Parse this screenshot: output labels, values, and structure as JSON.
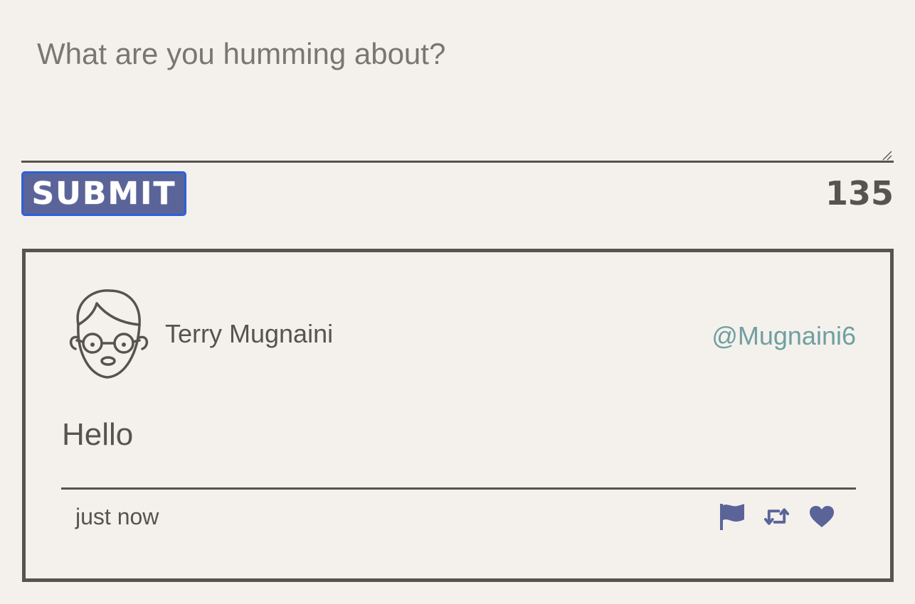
{
  "composer": {
    "placeholder": "What are you humming about?",
    "value": "",
    "submit_label": "SUBMIT",
    "char_count": "135"
  },
  "tweet": {
    "user_name": "Terry Mugnaini",
    "handle": "@Mugnaini6",
    "text": "Hello",
    "timestamp": "just now",
    "avatar_icon": "nerd-face-avatar",
    "actions": [
      "flag-icon",
      "retweet-icon",
      "heart-icon"
    ]
  },
  "colors": {
    "background": "#f4f1ec",
    "text": "#57534e",
    "accent": "#5b6499",
    "handle": "#6f9fa0",
    "focus_border": "#2b62d9"
  }
}
